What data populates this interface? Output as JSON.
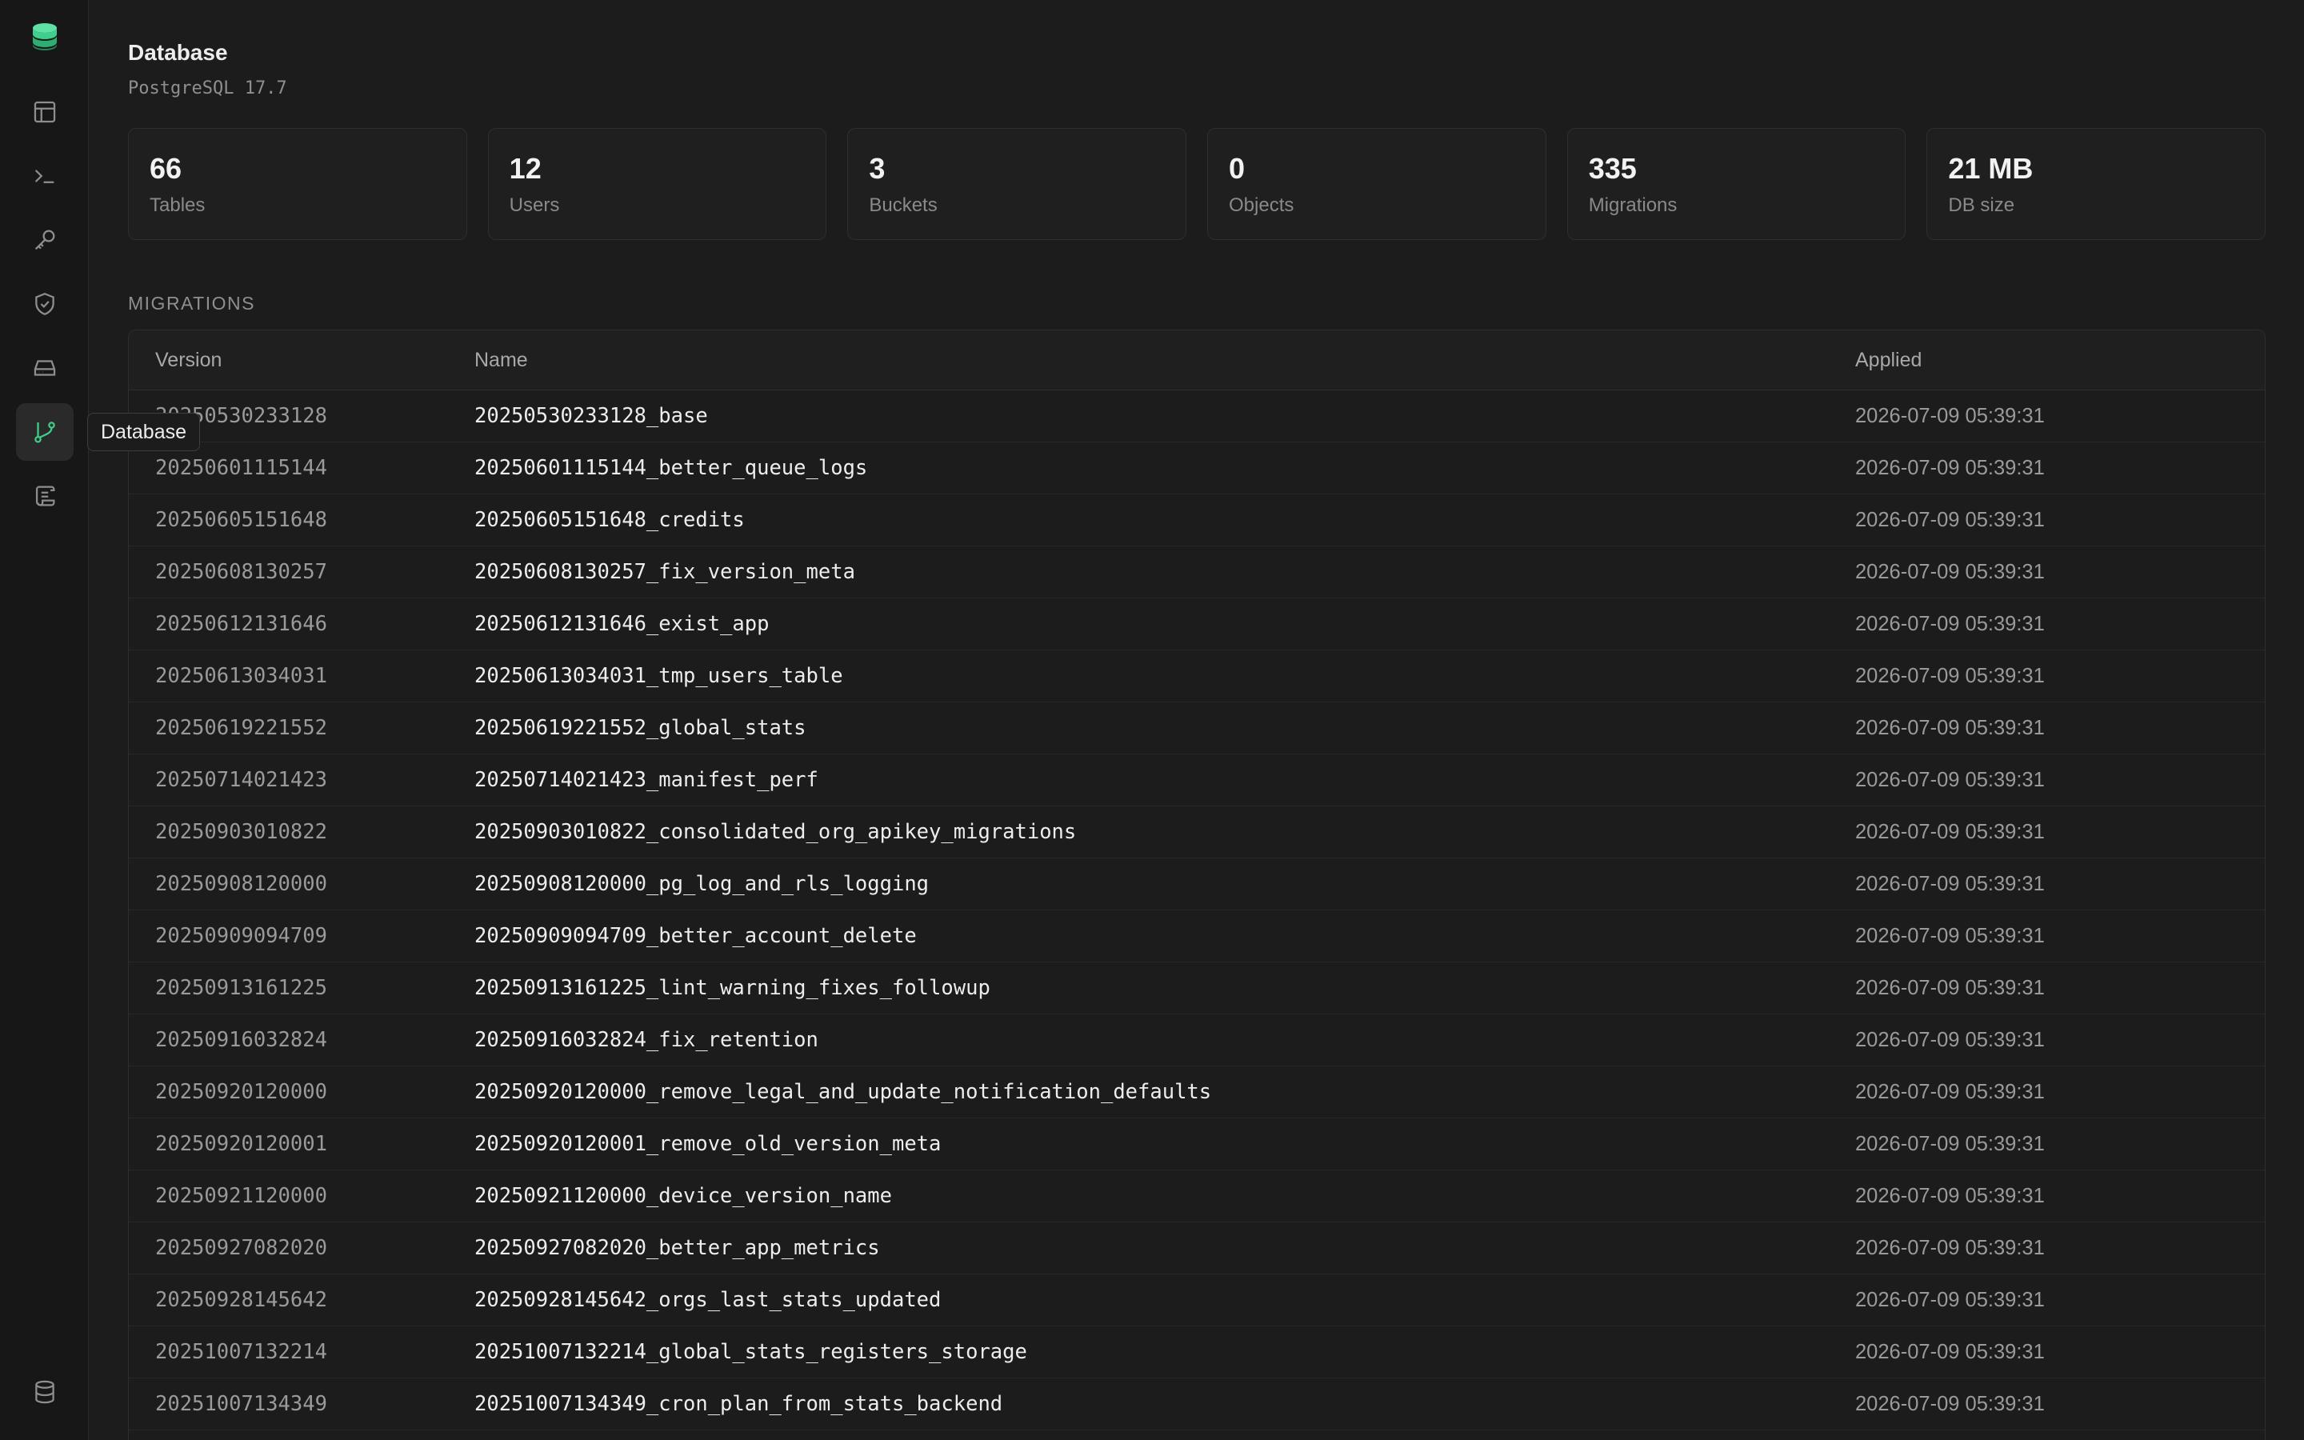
{
  "tooltip": "Database",
  "rail": {
    "items": [
      {
        "icon": "table-icon"
      },
      {
        "icon": "terminal-icon"
      },
      {
        "icon": "key-icon"
      },
      {
        "icon": "shield-check-icon"
      },
      {
        "icon": "storage-drive-icon"
      },
      {
        "icon": "git-branch-icon",
        "active": true
      },
      {
        "icon": "scroll-logs-icon"
      }
    ],
    "bottom_icon": "database-icon"
  },
  "header": {
    "title": "Database",
    "subtitle": "PostgreSQL 17.7"
  },
  "stats": [
    {
      "value": "66",
      "label": "Tables"
    },
    {
      "value": "12",
      "label": "Users"
    },
    {
      "value": "3",
      "label": "Buckets"
    },
    {
      "value": "0",
      "label": "Objects"
    },
    {
      "value": "335",
      "label": "Migrations"
    },
    {
      "value": "21 MB",
      "label": "DB size"
    }
  ],
  "migrations": {
    "section_label": "MIGRATIONS",
    "columns": {
      "version": "Version",
      "name": "Name",
      "applied": "Applied"
    },
    "rows": [
      {
        "version": "20250530233128",
        "name": "20250530233128_base",
        "applied": "2026-07-09 05:39:31"
      },
      {
        "version": "20250601115144",
        "name": "20250601115144_better_queue_logs",
        "applied": "2026-07-09 05:39:31"
      },
      {
        "version": "20250605151648",
        "name": "20250605151648_credits",
        "applied": "2026-07-09 05:39:31"
      },
      {
        "version": "20250608130257",
        "name": "20250608130257_fix_version_meta",
        "applied": "2026-07-09 05:39:31"
      },
      {
        "version": "20250612131646",
        "name": "20250612131646_exist_app",
        "applied": "2026-07-09 05:39:31"
      },
      {
        "version": "20250613034031",
        "name": "20250613034031_tmp_users_table",
        "applied": "2026-07-09 05:39:31"
      },
      {
        "version": "20250619221552",
        "name": "20250619221552_global_stats",
        "applied": "2026-07-09 05:39:31"
      },
      {
        "version": "20250714021423",
        "name": "20250714021423_manifest_perf",
        "applied": "2026-07-09 05:39:31"
      },
      {
        "version": "20250903010822",
        "name": "20250903010822_consolidated_org_apikey_migrations",
        "applied": "2026-07-09 05:39:31"
      },
      {
        "version": "20250908120000",
        "name": "20250908120000_pg_log_and_rls_logging",
        "applied": "2026-07-09 05:39:31"
      },
      {
        "version": "20250909094709",
        "name": "20250909094709_better_account_delete",
        "applied": "2026-07-09 05:39:31"
      },
      {
        "version": "20250913161225",
        "name": "20250913161225_lint_warning_fixes_followup",
        "applied": "2026-07-09 05:39:31"
      },
      {
        "version": "20250916032824",
        "name": "20250916032824_fix_retention",
        "applied": "2026-07-09 05:39:31"
      },
      {
        "version": "20250920120000",
        "name": "20250920120000_remove_legal_and_update_notification_defaults",
        "applied": "2026-07-09 05:39:31"
      },
      {
        "version": "20250920120001",
        "name": "20250920120001_remove_old_version_meta",
        "applied": "2026-07-09 05:39:31"
      },
      {
        "version": "20250921120000",
        "name": "20250921120000_device_version_name",
        "applied": "2026-07-09 05:39:31"
      },
      {
        "version": "20250927082020",
        "name": "20250927082020_better_app_metrics",
        "applied": "2026-07-09 05:39:31"
      },
      {
        "version": "20250928145642",
        "name": "20250928145642_orgs_last_stats_updated",
        "applied": "2026-07-09 05:39:31"
      },
      {
        "version": "20251007132214",
        "name": "20251007132214_global_stats_registers_storage",
        "applied": "2026-07-09 05:39:31"
      },
      {
        "version": "20251007134349",
        "name": "20251007134349_cron_plan_from_stats_backend",
        "applied": "2026-07-09 05:39:31"
      }
    ]
  }
}
